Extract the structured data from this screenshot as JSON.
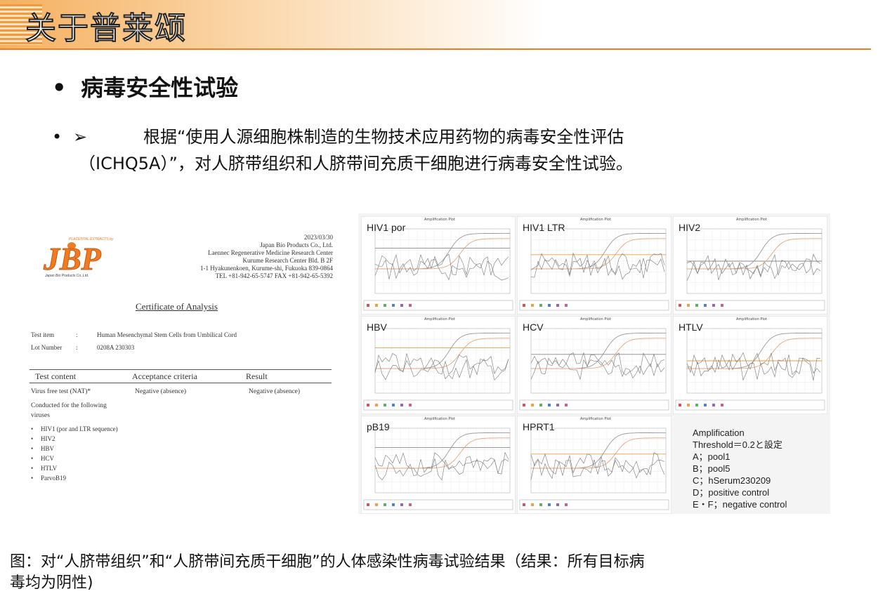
{
  "header": {
    "title": "关于普莱颂"
  },
  "heading": {
    "bullet": "•",
    "text": "病毒安全性试验"
  },
  "lead": {
    "bullet": "•",
    "arrow": "➢",
    "line1": "根据“使用人源细胞株制造的生物技术应用药物的病毒安全性评估",
    "line2": "（ICHQ5A）”，对人脐带组织和人脐带间充质干细胞进行病毒安全性试验。"
  },
  "certificate": {
    "logo_text": "JBP",
    "logo_top": "PLACENTAL EXTRACTS by",
    "logo_sub": "Japan Bio Products Co.,Ltd.",
    "date": "2023/03/30",
    "address": [
      "Japan Bio Products Co., Ltd.",
      "Laennec Regenerative Medicine Research Center",
      "Kurume Research Center Bld. B 2F",
      "1-1 Hyakunenkoen, Kurume-shi, Fukuoka 839-0864",
      "TEL +81-942-65-5747   FAX +81-942-65-5392"
    ],
    "title": "Certificate of Analysis",
    "test_item_label": "Test item",
    "test_item_value": "Human Mesenchymal Stem Cells from Umbilical Cord",
    "lot_label": "Lot Number",
    "lot_value": "0208A   230303",
    "colon": ":",
    "col_content": "Test content",
    "col_criteria": "Acceptance criteria",
    "col_result": "Result",
    "row_test": "Virus free test (NAT)*",
    "row_criteria": "Negative (absence)",
    "row_result": "Negative (absence)",
    "conducted_1": "Conducted for the following",
    "conducted_2": "viruses",
    "viruses": [
      "HIV1 (por and LTR sequence)",
      "HIV2",
      "HBV",
      "HCV",
      "HTLV",
      "ParvoB19"
    ]
  },
  "plots": {
    "plot_title": "Amplification Plot",
    "panels": [
      "HIV1 por",
      "HIV1 LTR",
      "HIV2",
      "HBV",
      "HCV",
      "HTLV",
      "pB19",
      "HPRT1"
    ],
    "notes": [
      "Amplification",
      "Threshold＝0.2と設定",
      "A；pool1",
      "B；pool5",
      "C；hSerum230209",
      "D；positive control",
      "E・F；negative control"
    ]
  },
  "caption": {
    "line1": "图：对“人脐带组织”和“人脐带间充质干细胞”的人体感染性病毒试验结果（结果：所有目标病",
    "line2": "毒均为阴性)"
  },
  "colors": {
    "accent": "#ef7d1e",
    "logo": "#f07b22",
    "threshold": "#f39a3a"
  }
}
